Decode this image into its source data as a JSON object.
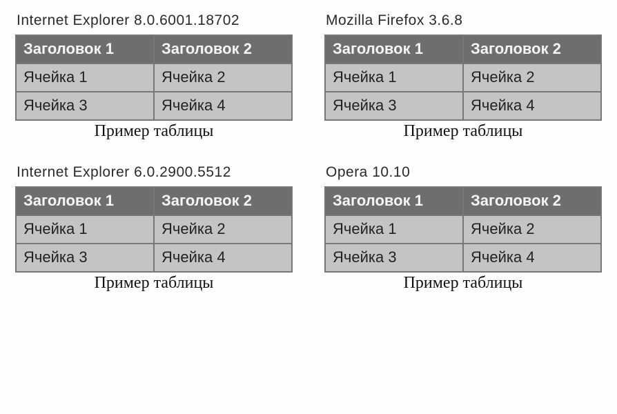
{
  "panels": [
    {
      "browser": "Internet Explorer 8.0.6001.18702",
      "headers": [
        "Заголовок 1",
        "Заголовок 2"
      ],
      "rows": [
        [
          "Ячейка 1",
          "Ячейка 2"
        ],
        [
          "Ячейка 3",
          "Ячейка 4"
        ]
      ],
      "caption": "Пример таблицы"
    },
    {
      "browser": "Mozilla Firefox 3.6.8",
      "headers": [
        "Заголовок 1",
        "Заголовок 2"
      ],
      "rows": [
        [
          "Ячейка 1",
          "Ячейка 2"
        ],
        [
          "Ячейка 3",
          "Ячейка 4"
        ]
      ],
      "caption": "Пример таблицы"
    },
    {
      "browser": "Internet Explorer 6.0.2900.5512",
      "headers": [
        "Заголовок 1",
        "Заголовок 2"
      ],
      "rows": [
        [
          "Ячейка 1",
          "Ячейка 2"
        ],
        [
          "Ячейка 3",
          "Ячейка 4"
        ]
      ],
      "caption": "Пример таблицы"
    },
    {
      "browser": "Opera 10.10",
      "headers": [
        "Заголовок 1",
        "Заголовок 2"
      ],
      "rows": [
        [
          "Ячейка 1",
          "Ячейка 2"
        ],
        [
          "Ячейка 3",
          "Ячейка 4"
        ]
      ],
      "caption": "Пример таблицы"
    }
  ]
}
